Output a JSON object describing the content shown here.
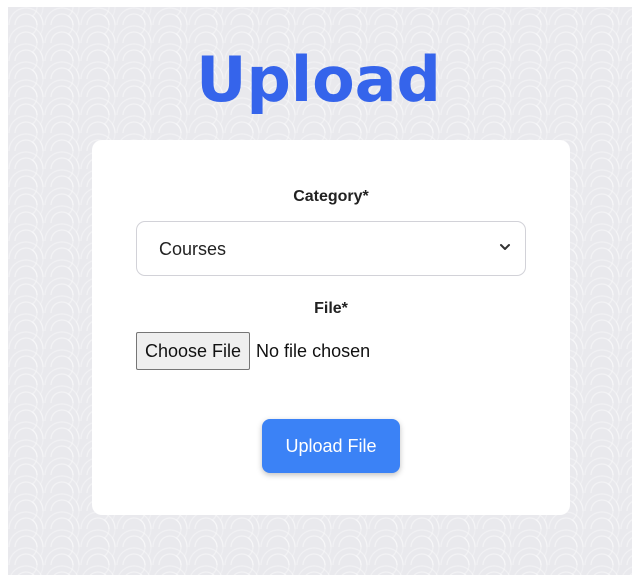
{
  "page": {
    "title": "Upload"
  },
  "form": {
    "category_label": "Category*",
    "category_selected": "Courses",
    "file_label": "File*",
    "choose_file_label": "Choose File",
    "file_status": "No file chosen",
    "submit_label": "Upload File"
  },
  "icons": {
    "select_arrow": "chevron-down-icon"
  },
  "colors": {
    "title": "#3564eb",
    "primary_button": "#3b82f6",
    "background": "#e9e9ed",
    "card": "#ffffff"
  }
}
